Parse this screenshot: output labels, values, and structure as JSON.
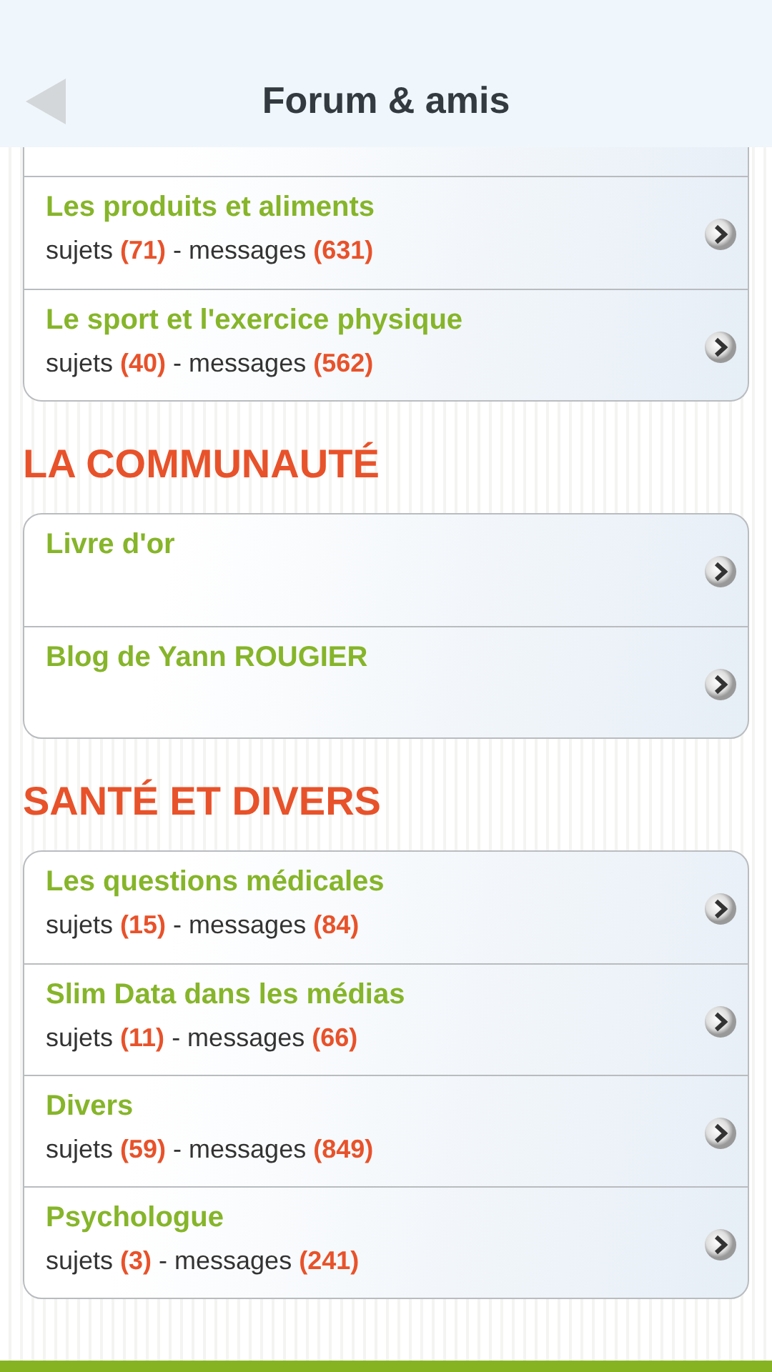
{
  "header": {
    "title": "Forum & amis"
  },
  "sections": [
    {
      "forums": [
        {
          "title": "Les produits et aliments",
          "stats": "sujets **(71)** - messages **(631)**"
        },
        {
          "title": "Le sport et l'exercice physique",
          "stats": "sujets **(40)** - messages **(562)**"
        }
      ]
    },
    {
      "heading": "LA COMMUNAUTÉ",
      "forums": [
        {
          "title": "Livre d'or"
        },
        {
          "title": "Blog de Yann ROUGIER"
        }
      ]
    },
    {
      "heading": "SANTÉ ET DIVERS",
      "forums": [
        {
          "title": "Les questions médicales",
          "stats": "sujets **(15)** - messages **(84)**"
        },
        {
          "title": "Slim Data dans les médias",
          "stats": "sujets **(11)** - messages **(66)**"
        },
        {
          "title": "Divers",
          "stats": "sujets **(59)** - messages **(849)**"
        },
        {
          "title": "Psychologue",
          "stats": "sujets **(3)** - messages **(241)**"
        }
      ]
    }
  ]
}
